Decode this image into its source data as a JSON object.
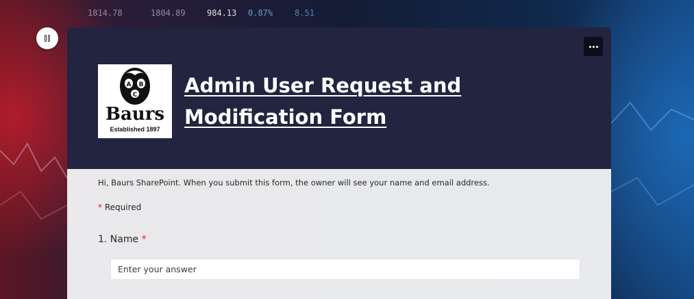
{
  "background": {
    "ticker_values": [
      "1814.78",
      "1804.89",
      "984.13",
      "0.87%",
      "8.51"
    ]
  },
  "pause_button": {
    "icon": "pause-icon"
  },
  "header": {
    "more_icon": "more-options-icon",
    "logo": {
      "word": "Baurs",
      "tagline": "Established 1897",
      "initials": "ABC"
    },
    "title": "Admin User Request and Modification Form"
  },
  "form": {
    "notice": "Hi, Baurs SharePoint. When you submit this form, the owner will see your name and email address.",
    "required_marker": "*",
    "required_label": "Required",
    "questions": [
      {
        "label": "1. Name",
        "required_marker": "*",
        "placeholder": "Enter your answer"
      }
    ]
  },
  "colors": {
    "header_bg": "#222440",
    "required_star": "#c4262e",
    "body_bg": "#f1f1f3"
  }
}
